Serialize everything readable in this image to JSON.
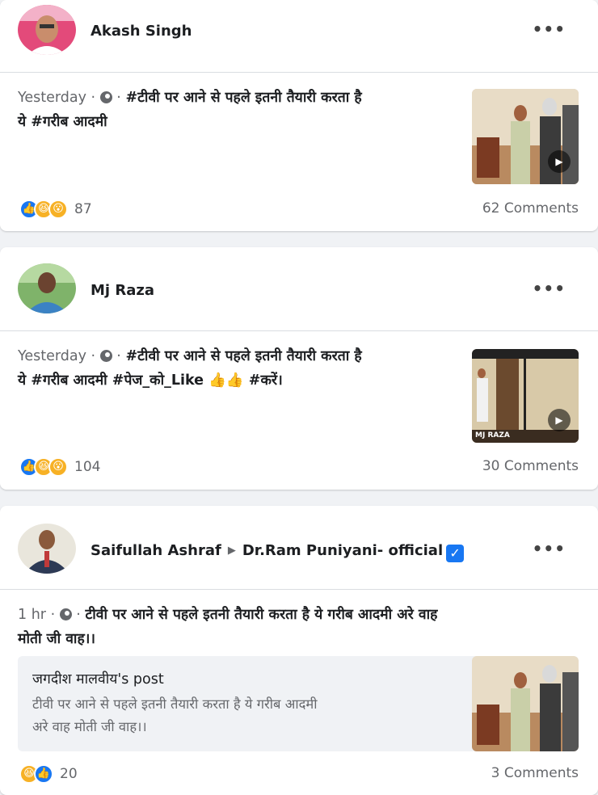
{
  "posts": [
    {
      "author": "Akash Singh",
      "time": "Yesterday",
      "separator": "·",
      "text_line1": "#टीवी पर आने से पहले इतनी तैयारी करता है",
      "text_line2": "ये #गरीब आदमी",
      "reaction_count": "87",
      "comments": "62 Comments",
      "more_label": "•••"
    },
    {
      "author": "Mj Raza",
      "time": "Yesterday",
      "separator": "·",
      "text_line1": "#टीवी पर आने से पहले इतनी तैयारी करता है",
      "text_line2": "ये #गरीब आदमी #पेज_को_Like 👍👍 #करें।",
      "thumb_watermark": "MJ RAZA",
      "reaction_count": "104",
      "comments": "30 Comments",
      "more_label": "•••"
    },
    {
      "author": "Saifullah Ashraf",
      "target": "Dr.Ram Puniyani- official",
      "time": "1 hr",
      "separator": "·",
      "text_line1": "टीवी पर आने से पहले इतनी तैयारी करता है ये गरीब आदमी अरे वाह",
      "text_line2": "मोती जी वाह।।",
      "shared_title": "जगदीश मालवीय's post",
      "shared_line1": "टीवी पर आने से पहले इतनी तैयारी करता है ये गरीब आदमी",
      "shared_line2": "अरे वाह मोती जी वाह।।",
      "reaction_count": "20",
      "comments": "3 Comments",
      "more_label": "•••"
    }
  ],
  "icons": {
    "globe": "globe-icon",
    "like": "like-reaction-icon",
    "haha": "haha-reaction-icon",
    "wow": "wow-reaction-icon",
    "verified": "verified-badge-icon",
    "play": "play-icon",
    "more": "more-options-icon"
  },
  "colors": {
    "accent": "#1877f2",
    "secondary_text": "#65676b",
    "background": "#f0f2f5"
  }
}
